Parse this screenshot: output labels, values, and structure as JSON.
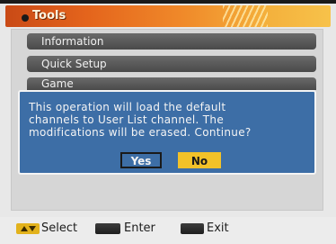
{
  "header": {
    "title": "Tools"
  },
  "menu": {
    "items": [
      {
        "label": "Information"
      },
      {
        "label": "Quick Setup"
      },
      {
        "label": "Game"
      }
    ]
  },
  "dialog": {
    "message": "This operation will load the default\nchannels to User List channel. The\nmodifications will be erased. Continue?",
    "yes_label": "Yes",
    "no_label": "No",
    "selected": "No"
  },
  "footer": {
    "hints": [
      {
        "key_icon": "up-down-arrows-icon",
        "label": "Select"
      },
      {
        "key_icon": "ok-key-icon",
        "label": "Enter"
      },
      {
        "key_icon": "menu-key-icon",
        "label": "Exit"
      }
    ]
  },
  "colors": {
    "title_bar_start": "#c94a16",
    "title_bar_end": "#f7c24a",
    "dialog_background": "#3d6ea6",
    "selected_button": "#f2c229",
    "menu_item": "#555555"
  }
}
